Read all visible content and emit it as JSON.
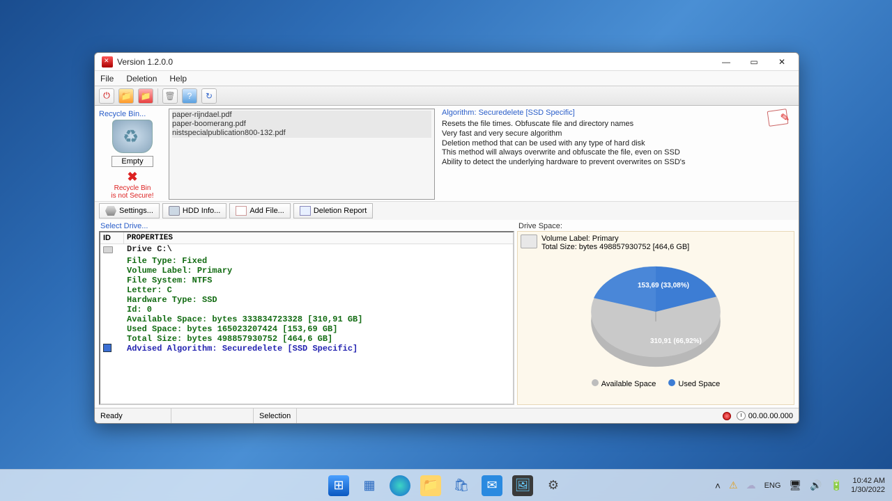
{
  "window": {
    "title": "Version 1.2.0.0",
    "menu": {
      "file": "File",
      "deletion": "Deletion",
      "help": "Help"
    }
  },
  "recycle": {
    "label": "Recycle Bin...",
    "empty": "Empty",
    "warn1": "Recycle Bin",
    "warn2": "is not Secure!"
  },
  "files": [
    "paper-rijndael.pdf",
    "paper-boomerang.pdf",
    "nistspecialpublication800-132.pdf"
  ],
  "algo": {
    "title": "Algorithm: Securedelete [SSD Specific]",
    "lines": [
      "Resets the file times. Obfuscate file and directory names",
      "Very fast and very secure algorithm",
      "Deletion method that can be used with any type of hard disk",
      "This method will always overwrite and obfuscate the file, even on SSD",
      "Ability to detect the underlying hardware to prevent overwrites on SSD's"
    ]
  },
  "buttons": {
    "settings": "Settings...",
    "hdd": "HDD Info...",
    "addfile": "Add File...",
    "report": "Deletion Report"
  },
  "drive": {
    "select_label": "Select Drive...",
    "head_id": "ID",
    "head_props": "PROPERTIES",
    "rows": {
      "drive": "Drive C:\\",
      "ftype": "File Type: Fixed",
      "vlabel": "Volume Label: Primary",
      "fs": "File System: NTFS",
      "letter": "Letter: C",
      "hw": "Hardware Type: SSD",
      "id": "Id: 0",
      "avail": "Available Space: bytes 333834723328 [310,91 GB]",
      "used": "Used Space: bytes 165023207424 [153,69 GB]",
      "total": "Total Size: bytes 498857930752 [464,6 GB]",
      "advised": "Advised Algorithm: Securedelete [SSD Specific]"
    }
  },
  "space": {
    "label": "Drive Space:",
    "vol": "Volume Label: Primary",
    "total": "Total Size: bytes 498857930752 [464,6 GB]",
    "slice_used": "153,69 (33,08%)",
    "slice_avail": "310,91 (66,92%)",
    "legend_avail": "Available Space",
    "legend_used": "Used Space"
  },
  "status": {
    "ready": "Ready",
    "selection": "Selection",
    "timer": "00.00.00.000"
  },
  "taskbar": {
    "lang": "ENG",
    "time": "10:42 AM",
    "date": "1/30/2022"
  },
  "chart_data": {
    "type": "pie",
    "title": "Drive Space",
    "series": [
      {
        "name": "Used Space",
        "value_gb": 153.69,
        "percent": 33.08,
        "color": "#3d7dd4"
      },
      {
        "name": "Available Space",
        "value_gb": 310.91,
        "percent": 66.92,
        "color": "#bdbdbd"
      }
    ]
  }
}
